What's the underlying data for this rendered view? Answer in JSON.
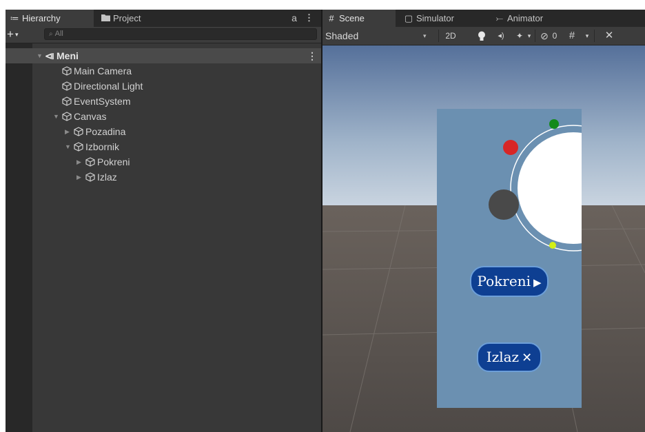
{
  "hierarchy_panel": {
    "tab_label": "Hierarchy",
    "tab_icon": "≔",
    "project_tab_label": "Project",
    "lock_icon": "a",
    "menu_icon": "⋮",
    "add_icon": "+",
    "add_caret": "▾",
    "search_icon": "⌕",
    "search_placeholder": "All",
    "scene": {
      "arrow": "▼",
      "icon": "⧏",
      "name": "Meni",
      "menu_icon": "⋮"
    },
    "items": [
      {
        "label": "Main Camera",
        "expanded": null
      },
      {
        "label": "Directional Light",
        "expanded": null
      },
      {
        "label": "EventSystem",
        "expanded": null
      },
      {
        "label": "Canvas",
        "expanded": true
      },
      {
        "label": "Pozadina",
        "expanded": false
      },
      {
        "label": "Izbornik",
        "expanded": true
      },
      {
        "label": "Pokreni",
        "expanded": false
      },
      {
        "label": "Izlaz",
        "expanded": false
      }
    ]
  },
  "scene_view": {
    "tabs": [
      {
        "icon": "#",
        "label": "Scene"
      },
      {
        "icon": "▢",
        "label": "Simulator"
      },
      {
        "icon": "⤚",
        "label": "Animator"
      }
    ],
    "shading_mode": "Shaded",
    "shading_caret": "▾",
    "mode_2d": "2D",
    "light_icon": "💡",
    "audio_icon": "◂)",
    "effects_icon": "✦",
    "effects_caret": "▾",
    "hidden_icon": "⊘",
    "hidden_count": "0",
    "grid_icon": "#",
    "grid_caret": "▾",
    "tools_icon": "✕"
  },
  "game_ui": {
    "start_label": "Pokreni",
    "start_icon": "▶",
    "exit_label": "Izlaz",
    "exit_icon": "✕"
  },
  "colors": {
    "panel_bg": "#383838",
    "sky_top": "#55709a",
    "sky_bottom": "#c9d4e0",
    "ground": "#5b5551",
    "canvas_bg": "#6b90b1",
    "button_bg": "#0e3f92",
    "planet_red": "#d72626",
    "planet_green": "#138a1a",
    "planet_yellow": "#d3ef16",
    "planet_gray": "#494949"
  }
}
